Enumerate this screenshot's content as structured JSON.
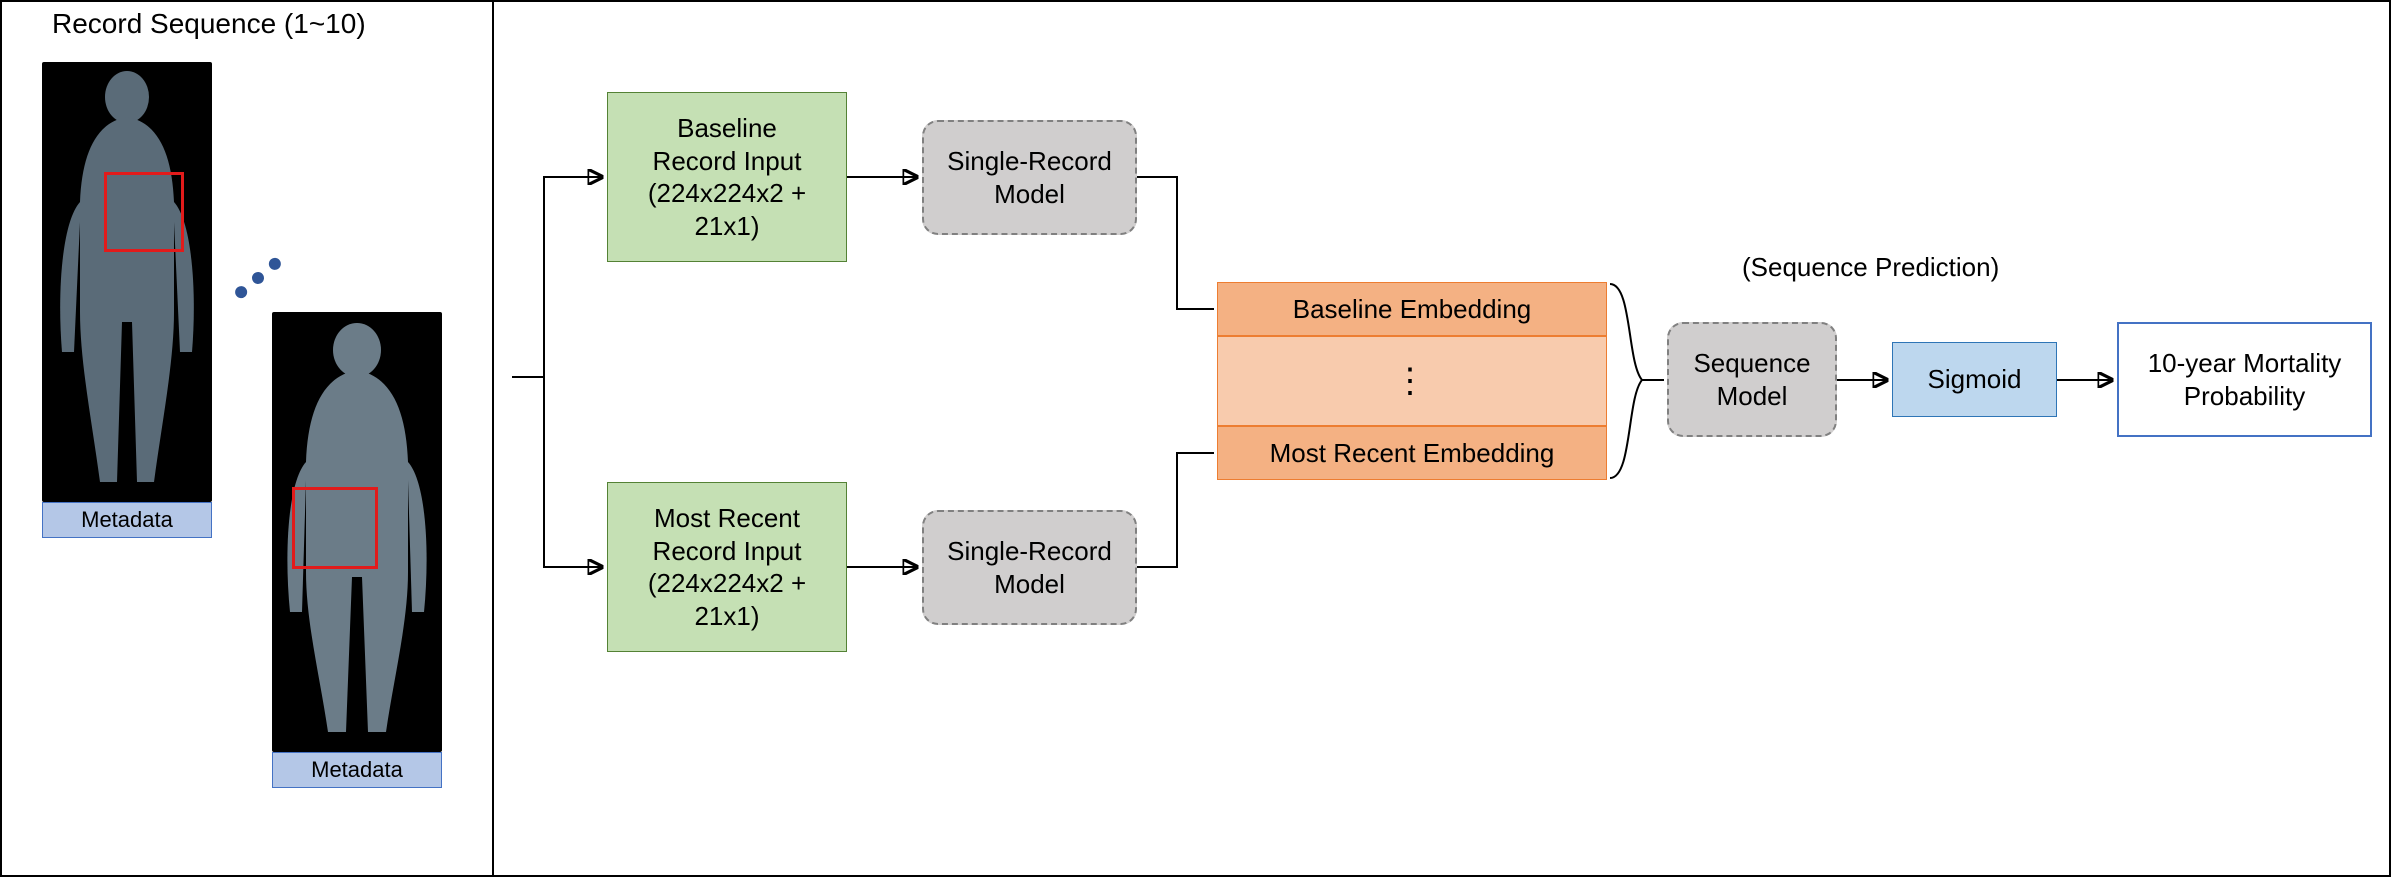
{
  "left": {
    "title": "Record Sequence (1~10)",
    "metadata_label": "Metadata"
  },
  "inputs": {
    "baseline": {
      "line1": "Baseline",
      "line2": "Record Input",
      "line3": "(224x224x2 +",
      "line4": "21x1)"
    },
    "recent": {
      "line1": "Most Recent",
      "line2": "Record Input",
      "line3": "(224x224x2 +",
      "line4": "21x1)"
    }
  },
  "models": {
    "single_record": "Single-Record\nModel",
    "sequence": "Sequence\nModel"
  },
  "embeddings": {
    "baseline": "Baseline Embedding",
    "dots": "⋮",
    "recent": "Most Recent Embedding"
  },
  "prediction": {
    "label": "(Sequence Prediction)",
    "sigmoid": "Sigmoid",
    "output": "10-year Mortality\nProbability"
  }
}
